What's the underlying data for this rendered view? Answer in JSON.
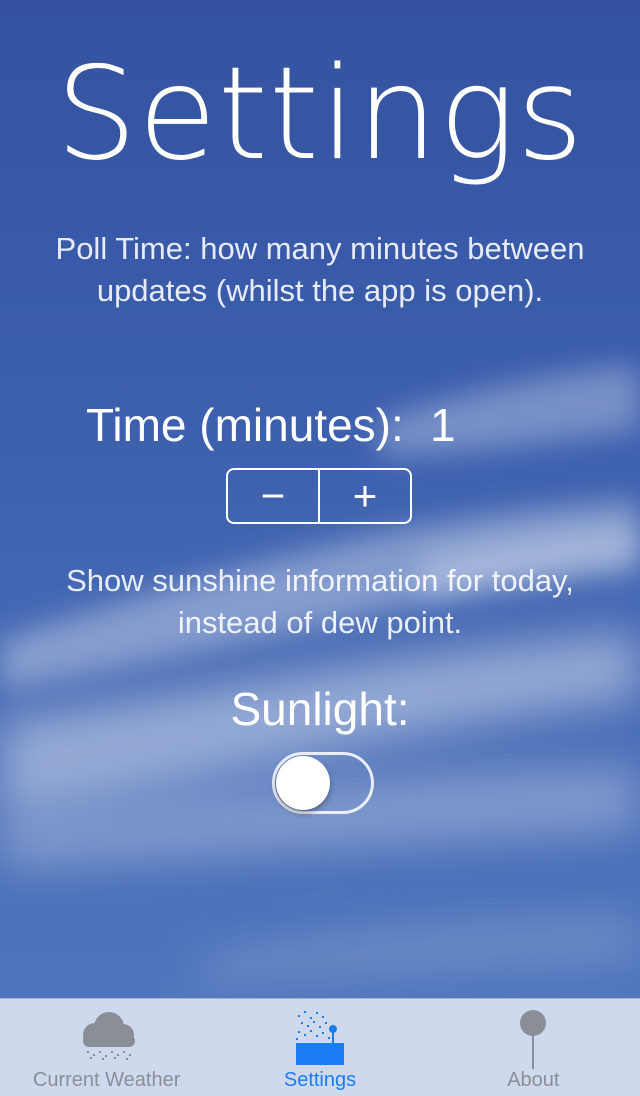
{
  "app": {
    "title": "Settings"
  },
  "poll_section": {
    "description": "Poll Time: how many minutes between updates (whilst the app is open).",
    "time_label": "Time (minutes):",
    "time_value": "1",
    "decrement_symbol": "−",
    "increment_symbol": "+"
  },
  "sunlight_section": {
    "description": "Show sunshine information for today, instead of dew point.",
    "label": "Sunlight:",
    "toggle_on": false
  },
  "tabbar": {
    "tabs": [
      {
        "label": "Current Weather",
        "icon": "cloud-rain-icon",
        "active": false
      },
      {
        "label": "Settings",
        "icon": "weather-station-icon",
        "active": true
      },
      {
        "label": "About",
        "icon": "pin-icon",
        "active": false
      }
    ]
  },
  "colors": {
    "sky_top": "#34529f",
    "sky_bottom": "#4f75bc",
    "tab_active": "#1a7cf5",
    "tab_inactive": "#8a8e96",
    "tabbar_bg": "#cfd9ee"
  }
}
